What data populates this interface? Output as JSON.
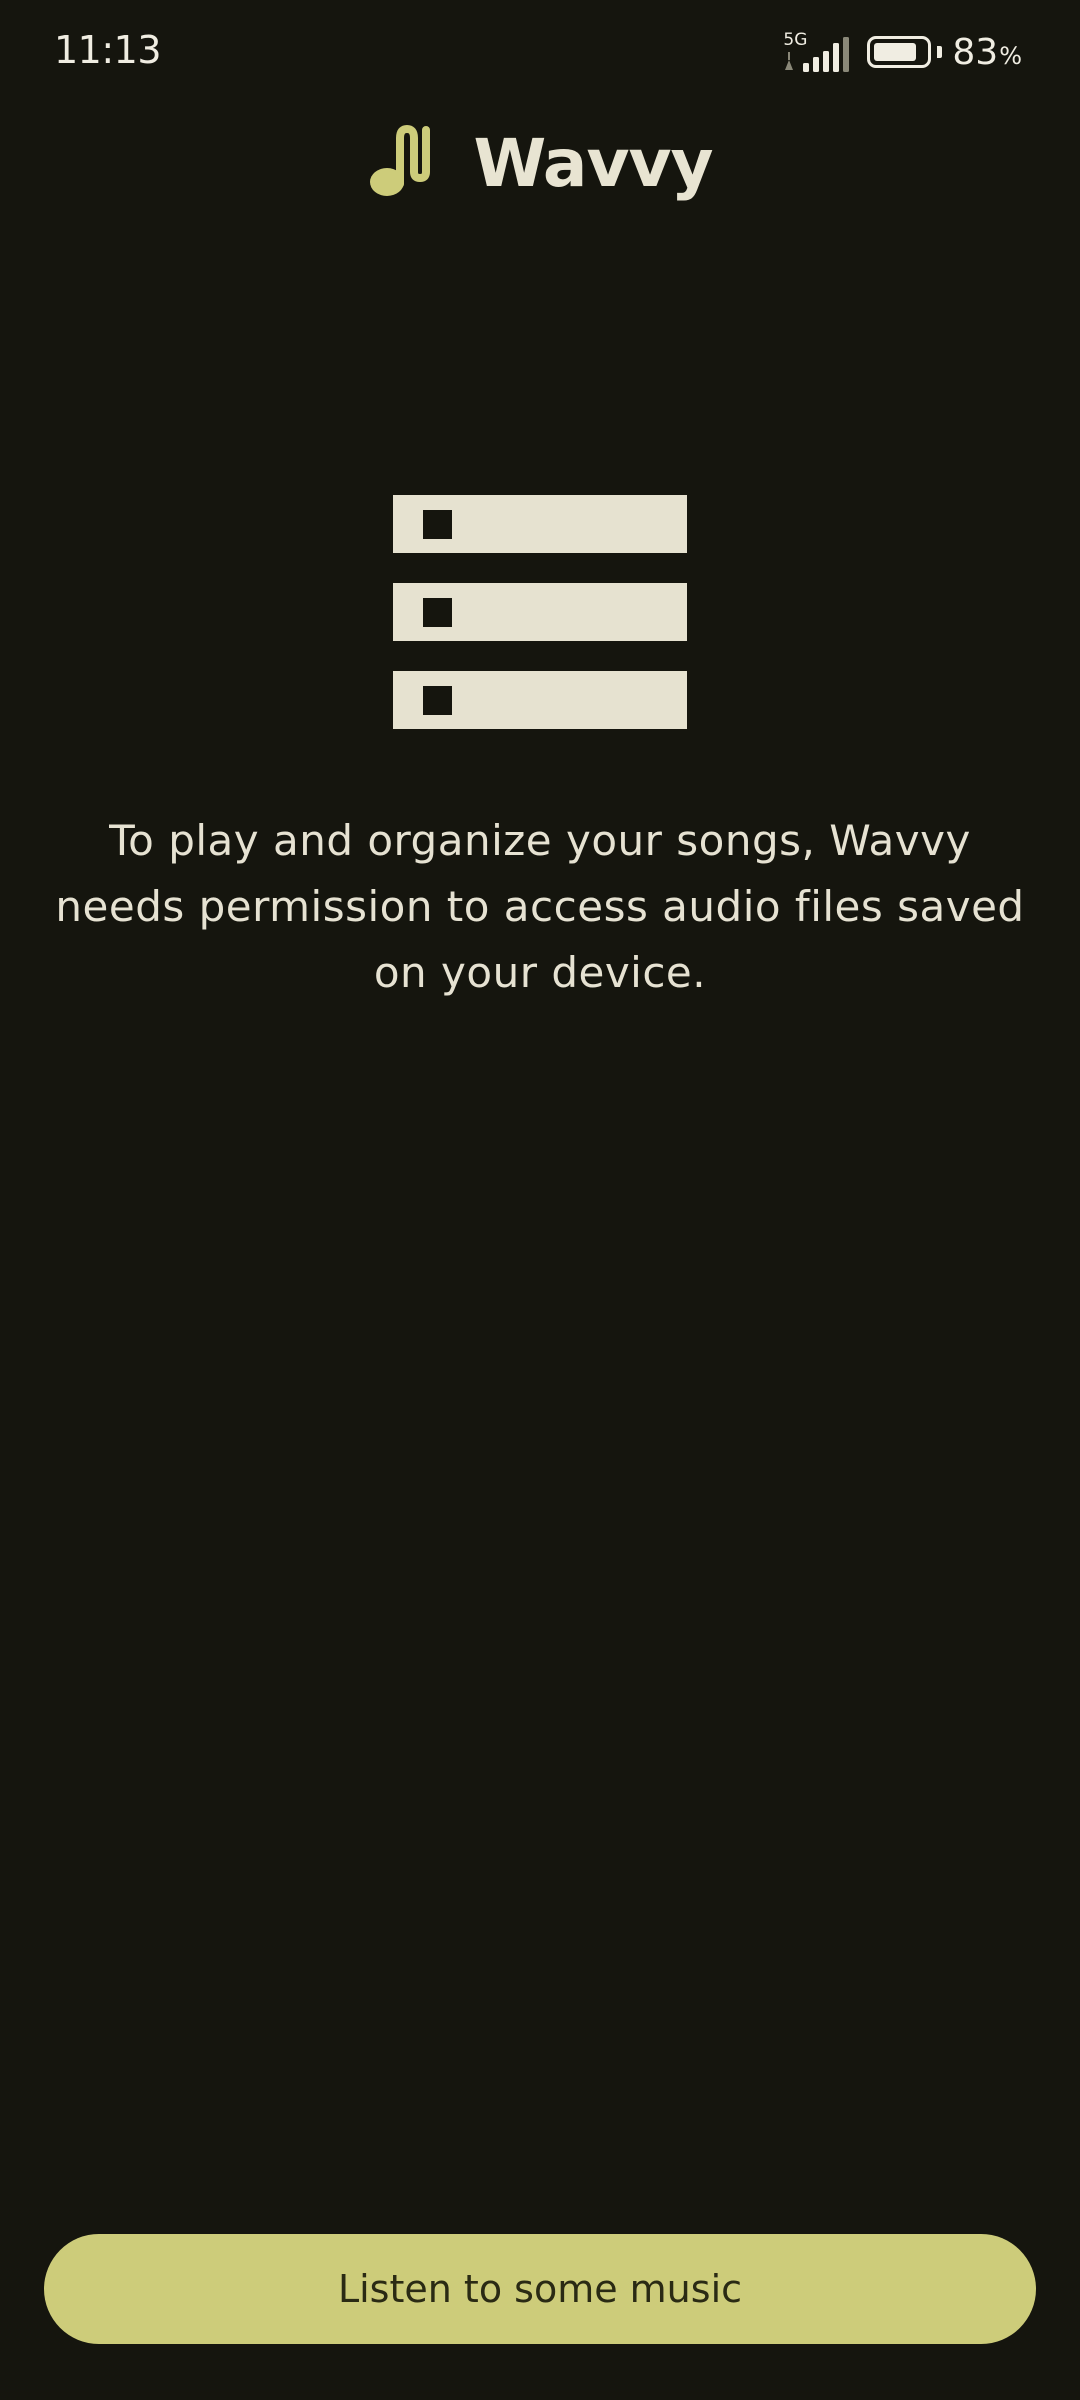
{
  "status_bar": {
    "time": "11:13",
    "network": "5G",
    "battery_percent": "83",
    "battery_percent_sign": "%",
    "battery_level": 0.83
  },
  "app": {
    "title": "Wavvy",
    "logo_icon": "music-note-icon",
    "accent_color": "#cdcc7a"
  },
  "permission": {
    "illustration_icon": "list-icon",
    "message": "To play and organize your songs, Wavvy needs permission to access audio files saved on your device."
  },
  "actions": {
    "primary_label": "Listen to some music"
  }
}
